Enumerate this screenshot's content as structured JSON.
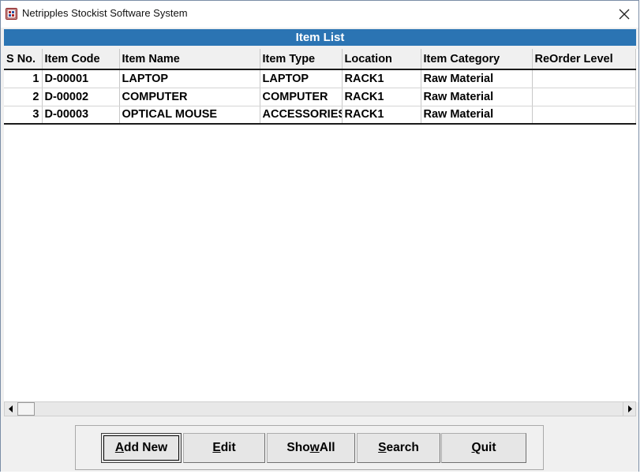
{
  "window": {
    "title": "Netripples Stockist Software System",
    "close_glyph": "✕"
  },
  "header": {
    "title": "Item List"
  },
  "table": {
    "columns": [
      "S No.",
      "Item Code",
      "Item Name",
      "Item  Type",
      "Location",
      "Item Category",
      "ReOrder Level"
    ],
    "rows": [
      [
        "1",
        "D-00001",
        "LAPTOP",
        "LAPTOP",
        "RACK1",
        "Raw Material",
        ""
      ],
      [
        "2",
        "D-00002",
        "COMPUTER",
        "COMPUTER",
        "RACK1",
        "Raw Material",
        ""
      ],
      [
        "3",
        "D-00003",
        "OPTICAL MOUSE",
        "ACCESSORIES",
        "RACK1",
        "Raw Material",
        ""
      ]
    ]
  },
  "buttons": {
    "add_new": {
      "pre": "",
      "key": "A",
      "post": "dd New"
    },
    "edit": {
      "pre": "",
      "key": "E",
      "post": "dit"
    },
    "show_all": {
      "pre": "Sho",
      "key": "w",
      "post": " All"
    },
    "search": {
      "pre": "",
      "key": "S",
      "post": "earch"
    },
    "quit": {
      "pre": "",
      "key": "Q",
      "post": "uit"
    }
  },
  "icons": {
    "app": "app-icon",
    "close": "close-icon",
    "scroll_left": "arrow-left-icon",
    "scroll_right": "arrow-right-icon"
  },
  "colors": {
    "header_band": "#2b74b3",
    "header_text": "#ffffff",
    "app_icon": "#8a1b1b"
  }
}
